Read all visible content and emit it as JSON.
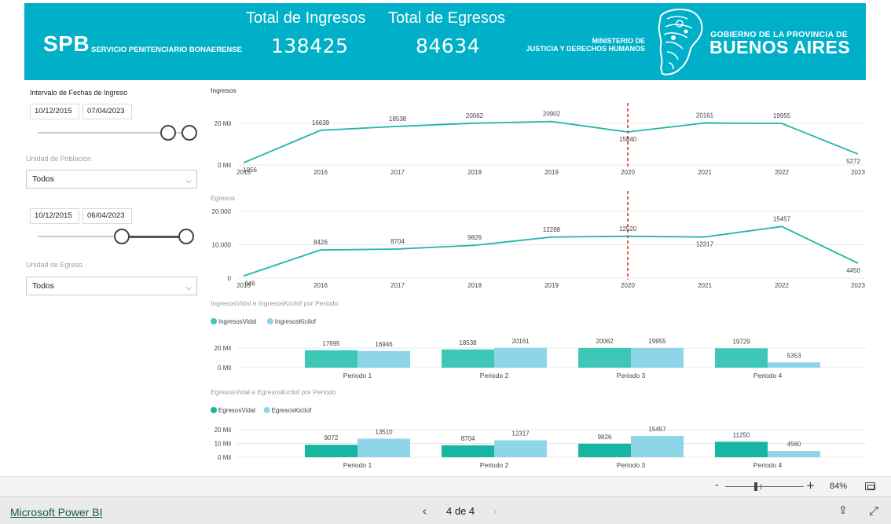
{
  "header": {
    "spb": "SPB",
    "spb_subtitle": "SERVICIO PENITENCIARIO BONAERENSE",
    "kpi_ingresos": {
      "title": "Total de Ingresos",
      "value": "138425"
    },
    "kpi_egresos": {
      "title": "Total de Egresos",
      "value": "84634"
    },
    "ministerio_line1": "MINISTERIO DE",
    "ministerio_line2": "JUSTICIA Y DERECHOS HUMANOS",
    "gobierno_line1": "GOBIERNO DE LA PROVINCIA DE",
    "gobierno_line2": "BUENOS AIRES",
    "banner_color": "#00b0c8"
  },
  "filters": {
    "ingreso_label": "Intervalo de Fechas de Ingreso",
    "ingreso_start": "10/12/2015",
    "ingreso_end": "07/04/2023",
    "unidad_poblacion_label": "Unidad de Poblacion",
    "unidad_poblacion_value": "Todos",
    "egreso_start": "10/12/2015",
    "egreso_end": "06/04/2023",
    "unidad_egreso_label": "Unidad de Egreso",
    "unidad_egreso_value": "Todos"
  },
  "chart_data": [
    {
      "type": "line",
      "title": "Ingresos",
      "x": [
        "2015",
        "2016",
        "2017",
        "2018",
        "2019",
        "2020",
        "2021",
        "2022",
        "2023"
      ],
      "series": [
        {
          "values": [
            1056,
            16639,
            18538,
            20062,
            20902,
            15840,
            20161,
            19955,
            5272
          ]
        }
      ],
      "yticks": [
        "0 Mil",
        "20 Mil"
      ],
      "ylim": [
        0,
        20000
      ],
      "reference_line_x": "2020",
      "color": "#1fb5a6",
      "ref_color": "#e85a5a"
    },
    {
      "type": "line",
      "title": "Egresos",
      "x": [
        "2015",
        "2016",
        "2017",
        "2018",
        "2019",
        "2020",
        "2021",
        "2022",
        "2023"
      ],
      "series": [
        {
          "values": [
            646,
            8426,
            8704,
            9826,
            12288,
            12520,
            12317,
            15457,
            4450
          ]
        }
      ],
      "yticks": [
        "0",
        "10.000",
        "20.000"
      ],
      "ylim": [
        0,
        20000
      ],
      "reference_line_x": "2020",
      "color": "#1fb5a6",
      "ref_color": "#e85a5a"
    },
    {
      "type": "bar",
      "title": "IngresosVidal e IngresosKicilof por Periodo",
      "categories": [
        "Periodo 1",
        "Periodo 2",
        "Periodo 3",
        "Periodo 4"
      ],
      "series": [
        {
          "name": "IngresosVidal",
          "values": [
            17695,
            18538,
            20062,
            19729
          ],
          "color": "#3ec7b7"
        },
        {
          "name": "IngresosKicilof",
          "values": [
            16946,
            20161,
            19955,
            5353
          ],
          "color": "#8fd5ea"
        }
      ],
      "yticks": [
        "0 Mil",
        "20 Mil"
      ],
      "ylim": [
        0,
        20000
      ]
    },
    {
      "type": "bar",
      "title": "EgresosVidal e EgresosKicilof por Periodo",
      "categories": [
        "Periodo 1",
        "Periodo 2",
        "Periodo 3",
        "Periodo 4"
      ],
      "series": [
        {
          "name": "EgresosVidal",
          "values": [
            9072,
            8704,
            9826,
            11250
          ],
          "color": "#18b5a3"
        },
        {
          "name": "EgresosKicilof",
          "values": [
            13510,
            12317,
            15457,
            4560
          ],
          "color": "#8fd5ea"
        }
      ],
      "yticks": [
        "0 Mil",
        "10 Mil",
        "20 Mil"
      ],
      "ylim": [
        0,
        20000
      ]
    }
  ],
  "zoom": {
    "minus": "-",
    "plus": "+",
    "percent": "84%"
  },
  "footer": {
    "powerbi_link": "Microsoft Power BI",
    "page_indicator": "4 de 4",
    "prev": "‹",
    "next": "›"
  }
}
